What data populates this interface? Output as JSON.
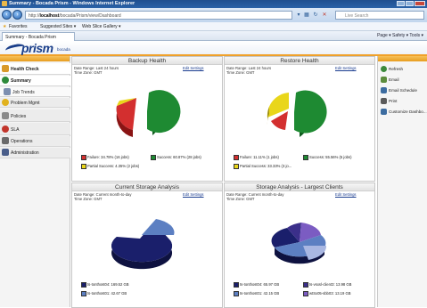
{
  "window": {
    "title": "Summary - Bocada Prism - Windows Internet Explorer"
  },
  "browser": {
    "back_icon": "back-arrow-icon",
    "forward_icon": "forward-arrow-icon",
    "url_prefix": "http://",
    "url_host": "localhost",
    "url_path": "/bocada/Prism/view/Dashboard",
    "search_placeholder": "Live Search",
    "favorites_label": "Favorites",
    "suggested_sites": "Suggested Sites ▾",
    "web_slice": "Web Slice Gallery ▾",
    "tab_label": "Summary - Bocada Prism",
    "tools_text": "Page ▾ Safety ▾ Tools ▾"
  },
  "app": {
    "logo_text": "prism",
    "logo_sub": "bocada"
  },
  "sidebar": {
    "items": [
      {
        "label": "Health Check",
        "icon": "health-check-icon",
        "color": "#d99a2b"
      },
      {
        "label": "Summary",
        "icon": "summary-icon",
        "color": "#2f8a3a"
      },
      {
        "label": "Job Trends",
        "icon": "job-trends-icon",
        "color": "#7d8fb0"
      },
      {
        "label": "Problem Mgmt",
        "icon": "problem-mgmt-icon",
        "color": "#e1b21f"
      },
      {
        "label": "Policies",
        "icon": "policies-icon",
        "color": "#8a8a8a"
      },
      {
        "label": "SLA",
        "icon": "sla-icon",
        "color": "#c2352b"
      },
      {
        "label": "Operations",
        "icon": "operations-icon",
        "color": "#6a6a6a"
      },
      {
        "label": "Administration",
        "icon": "administration-icon",
        "color": "#4a5e8a"
      }
    ]
  },
  "right_panel": {
    "items": [
      {
        "label": "Refresh",
        "icon": "refresh-icon",
        "color": "#3c8a3c"
      },
      {
        "label": "Email",
        "icon": "email-icon",
        "color": "#5c8c3c"
      },
      {
        "label": "Email Schedule",
        "icon": "email-schedule-icon",
        "color": "#3c6ca0"
      },
      {
        "label": "Print",
        "icon": "print-icon",
        "color": "#5a5a5a"
      },
      {
        "label": "Customize Dashbo...",
        "icon": "customize-icon",
        "color": "#3c6ca0"
      }
    ]
  },
  "panels": {
    "backup": {
      "title": "Backup Health",
      "date_range": "Date Range: Last 24 hours",
      "time_zone": "Time Zone: GMT",
      "edit": "Edit Settings",
      "legend": [
        {
          "label": "Failure: 34.78% (16 jobs)",
          "color": "#d32f2f"
        },
        {
          "label": "Success: 60.87% (28 jobs)",
          "color": "#1e8a32"
        },
        {
          "label": "Partial Success: 4.35% (2 jobs)",
          "color": "#e9d61a"
        }
      ]
    },
    "restore": {
      "title": "Restore Health",
      "date_range": "Date Range: Last 24 hours",
      "time_zone": "Time Zone: GMT",
      "edit": "Edit Settings",
      "legend": [
        {
          "label": "Failure: 11.11% (1 jobs)",
          "color": "#d32f2f"
        },
        {
          "label": "Success: 55.56% (5 jobs)",
          "color": "#1e8a32"
        },
        {
          "label": "Partial Success: 33.33% (3 jo...",
          "color": "#e9d61a"
        }
      ]
    },
    "storage": {
      "title": "Current Storage Analysis",
      "date_range": "Date Range: Current month-to-day",
      "time_zone": "Time Zone: GMT",
      "edit": "Edit Settings",
      "legend": [
        {
          "label": "ts-tonthost04: 169.52 GB",
          "color": "#1a1f6b"
        },
        {
          "label": "ts-tonthost01: 42.67 GB",
          "color": "#5c7fc2"
        }
      ]
    },
    "clients": {
      "title": "Storage Analysis - Largest Clients",
      "date_range": "Date Range: Current month-to-day",
      "time_zone": "Time Zone: GMT",
      "edit": "Edit Settings",
      "legend": [
        {
          "label": "ts-tonthost04: 65.97 GB",
          "color": "#1a1f6b"
        },
        {
          "label": "ts-vsxsl-client3: 13.98 GB",
          "color": "#3b2f8a"
        },
        {
          "label": "ts-tonthost01: 42.15 GB",
          "color": "#5c7fc2"
        },
        {
          "label": "wtSx05-sbb03: 13.19 GB",
          "color": "#7b5cc2"
        }
      ]
    }
  }
}
